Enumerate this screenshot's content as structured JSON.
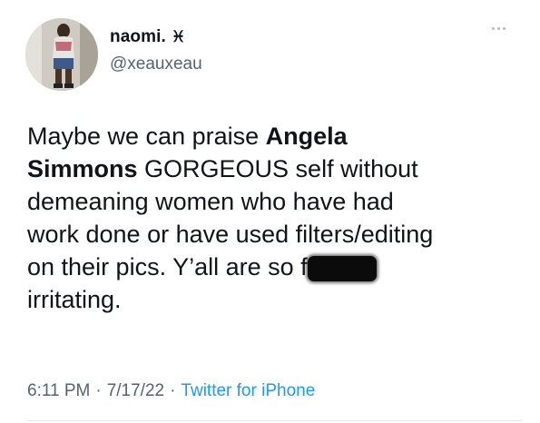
{
  "user": {
    "display_name": "naomi.",
    "name_symbol": "♓︎",
    "handle": "@xeauxeau"
  },
  "more_icon": "ellipsis-icon",
  "tweet": {
    "line1_pre": "Maybe we can praise ",
    "line1_bold": "Angela",
    "line2_bold": "Simmons",
    "line2_post": " GORGEOUS self without",
    "line3": "demeaning women who have had",
    "line4": "work done or have used filters/editing",
    "line5_pre": "on their pics. Y’all are so ",
    "line5_redacted": "fucking",
    "line6": "irritating."
  },
  "meta": {
    "time": "6:11 PM",
    "dot1": "·",
    "date": "7/17/22",
    "dot2": "·",
    "source": "Twitter for iPhone"
  },
  "colors": {
    "text": "#0f1419",
    "secondary": "#536471",
    "link": "#1d9bf0"
  }
}
